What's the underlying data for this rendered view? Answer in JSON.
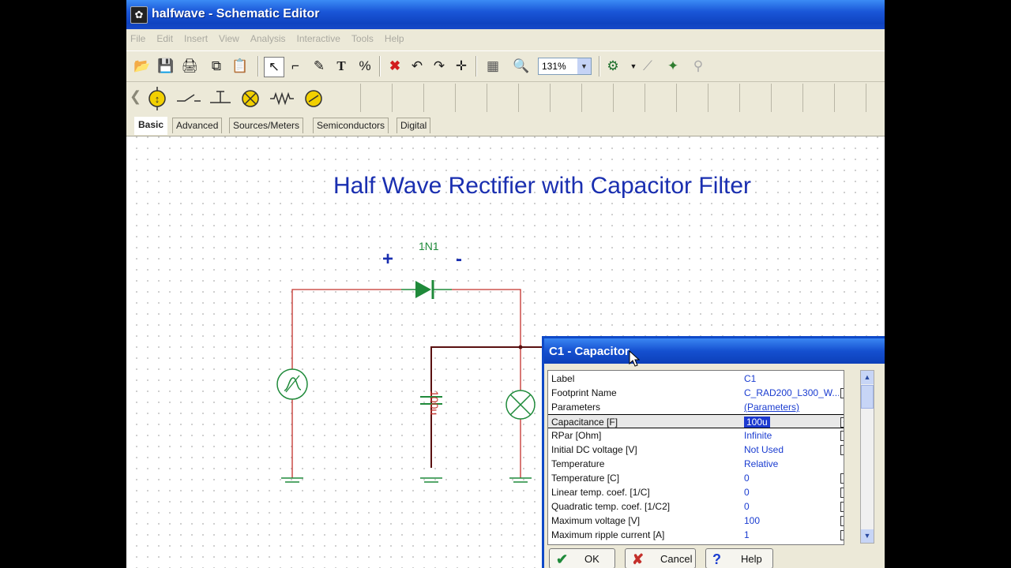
{
  "window": {
    "title": "halfwave - Schematic Editor"
  },
  "menu": [
    "File",
    "Edit",
    "Insert",
    "View",
    "Analysis",
    "Interactive",
    "Tools",
    "Help"
  ],
  "toolbar": {
    "zoom_value": "131%",
    "icons": [
      "open-icon",
      "save-icon",
      "print-icon",
      "copy-icon",
      "paste-icon",
      "select-icon",
      "wire-icon",
      "pencil-icon",
      "text-icon",
      "formula-icon",
      "delete-icon",
      "undo-icon",
      "redo-icon",
      "node-icon",
      "grid-icon",
      "zoom-icon",
      "probe-icon",
      "pin-icon",
      "run-icon",
      "help-icon"
    ]
  },
  "component_tabs": [
    "Basic",
    "Advanced",
    "Sources/Meters",
    "Semiconductors",
    "Digital"
  ],
  "active_tab": "Basic",
  "schematic": {
    "title": "Half Wave Rectifier with Capacitor Filter",
    "diode_label": "1N1",
    "plus_sign": "+",
    "minus_sign": "-",
    "capacitor_label": "100u",
    "colors": {
      "wire": "#c4302b",
      "diode": "#1f8a3a",
      "component": "#1f8a3a",
      "title": "#1a2fb0",
      "label": "#c4302b"
    }
  },
  "dialog": {
    "title": "C1 - Capacitor",
    "rows": [
      {
        "key": "Label",
        "value": "C1",
        "checkbox": false
      },
      {
        "key": "Footprint Name",
        "value": "C_RAD200_L300_W...",
        "checkbox": true
      },
      {
        "key": "Parameters",
        "value": "(Parameters)",
        "checkbox": false
      },
      {
        "key": "Capacitance   [F]",
        "value": "100u",
        "checkbox": true,
        "selected": true
      },
      {
        "key": "RPar        [Ohm]",
        "value": "Infinite",
        "checkbox": true
      },
      {
        "key": "Initial DC voltage  [V]",
        "value": "Not Used",
        "checkbox": true
      },
      {
        "key": "Temperature",
        "value": "Relative",
        "checkbox": false
      },
      {
        "key": "Temperature [C]",
        "value": "0",
        "checkbox": true
      },
      {
        "key": "Linear temp. coef.  [1/C]",
        "value": "0",
        "checkbox": true
      },
      {
        "key": "Quadratic temp. coef.  [1/C2]",
        "value": "0",
        "checkbox": true
      },
      {
        "key": "Maximum voltage [V]",
        "value": "100",
        "checkbox": true
      },
      {
        "key": "Maximum ripple current [A]",
        "value": "1",
        "checkbox": true
      }
    ],
    "buttons": {
      "ok": "OK",
      "cancel": "Cancel",
      "help": "Help"
    }
  }
}
